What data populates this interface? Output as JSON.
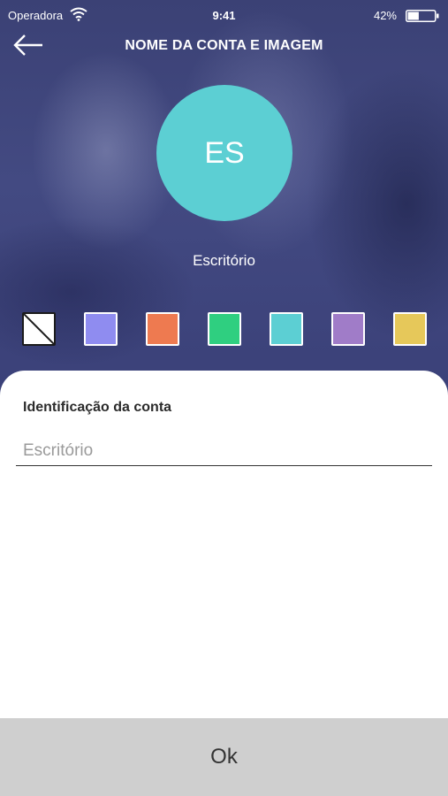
{
  "status_bar": {
    "carrier": "Operadora",
    "time": "9:41",
    "battery_percent": "42%",
    "battery_level": 0.42,
    "icons": [
      "wifi-icon",
      "battery-icon"
    ]
  },
  "header": {
    "title": "NOME DA CONTA E IMAGEM",
    "back_icon": "arrow-left-icon"
  },
  "avatar": {
    "initials": "ES",
    "color": "#5ccfd3"
  },
  "account_name": "Escritório",
  "color_options": [
    {
      "name": "none",
      "color": "#ffffff"
    },
    {
      "name": "periwinkle",
      "color": "#8f8cf0"
    },
    {
      "name": "orange",
      "color": "#ee7a50"
    },
    {
      "name": "green",
      "color": "#2fcf80"
    },
    {
      "name": "cyan",
      "color": "#5ccfd3"
    },
    {
      "name": "purple",
      "color": "#a07cc8"
    },
    {
      "name": "yellow",
      "color": "#e6c85a"
    }
  ],
  "form": {
    "label": "Identificação da conta",
    "placeholder": "Escritório",
    "value": ""
  },
  "footer": {
    "ok_label": "Ok"
  }
}
